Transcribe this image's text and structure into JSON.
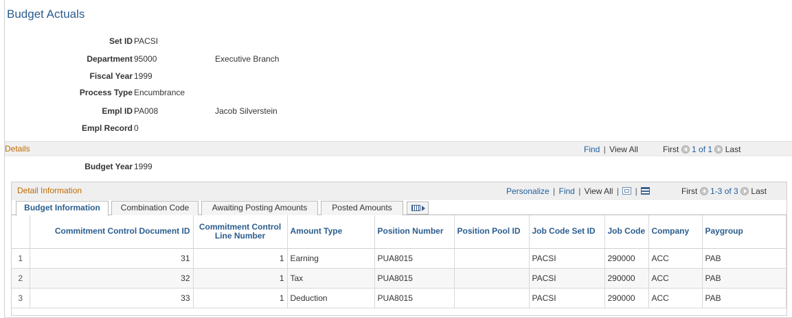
{
  "page": {
    "title": "Budget Actuals"
  },
  "header_fields": [
    {
      "label": "Set ID",
      "value": "PACSI",
      "desc": ""
    },
    {
      "label": "Department",
      "value": "95000",
      "desc": "Executive Branch"
    },
    {
      "label": "Fiscal Year",
      "value": "1999",
      "desc": ""
    },
    {
      "label": "Process Type",
      "value": "Encumbrance",
      "desc": ""
    },
    {
      "label": "Empl ID",
      "value": "PA008",
      "desc": "Jacob Silverstein"
    },
    {
      "label": "Empl Record",
      "value": "0",
      "desc": ""
    }
  ],
  "details": {
    "title": "Details",
    "find": "Find",
    "view_all": "View All",
    "first": "First",
    "pager": "1 of 1",
    "last": "Last",
    "budget_year_label": "Budget Year",
    "budget_year_value": "1999"
  },
  "detail_info": {
    "title": "Detail Information",
    "personalize": "Personalize",
    "find": "Find",
    "view_all": "View All",
    "first": "First",
    "pager": "1-3 of 3",
    "last": "Last",
    "tabs": [
      {
        "label": "Budget Information"
      },
      {
        "label": "Combination Code"
      },
      {
        "label": "Awaiting Posting Amounts"
      },
      {
        "label": "Posted Amounts"
      }
    ],
    "columns": [
      "",
      "Commitment Control Document ID",
      "Commitment Control Line Number",
      "Amount Type",
      "Position Number",
      "Position Pool ID",
      "Job Code Set ID",
      "Job Code",
      "Company",
      "Paygroup"
    ],
    "rows": [
      {
        "n": "1",
        "doc_id": "31",
        "line": "1",
        "amount_type": "Earning",
        "position": "PUA8015",
        "pool": "",
        "setid": "PACSI",
        "jobcode": "290000",
        "company": "ACC",
        "paygroup": "PAB"
      },
      {
        "n": "2",
        "doc_id": "32",
        "line": "1",
        "amount_type": "Tax",
        "position": "PUA8015",
        "pool": "",
        "setid": "PACSI",
        "jobcode": "290000",
        "company": "ACC",
        "paygroup": "PAB"
      },
      {
        "n": "3",
        "doc_id": "33",
        "line": "1",
        "amount_type": "Deduction",
        "position": "PUA8015",
        "pool": "",
        "setid": "PACSI",
        "jobcode": "290000",
        "company": "ACC",
        "paygroup": "PAB"
      }
    ]
  },
  "icons": {
    "prev": "arrow-left-icon",
    "next": "arrow-right-icon",
    "zoom": "zoom-grid-icon",
    "download": "download-grid-icon",
    "show_all_columns": "show-all-columns-icon"
  },
  "colors": {
    "title": "#2a5c8e",
    "section_title": "#c06a00",
    "link": "#1f5d9c"
  }
}
